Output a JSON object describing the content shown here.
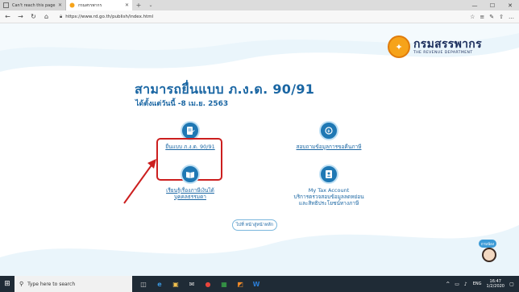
{
  "browser": {
    "tabs": [
      {
        "label": "Can't reach this page",
        "active": false,
        "icon": "broken-page-icon"
      },
      {
        "label": "กรมสรรพากร",
        "active": true,
        "icon": "rd-favicon"
      }
    ],
    "url": "https://www.rd.go.th/publish/index.html",
    "new_tab_glyph": "+",
    "tab_list_glyph": "⌄",
    "window_controls": [
      "—",
      "☐",
      "✕"
    ],
    "nav_glyphs": {
      "back": "←",
      "forward": "→",
      "refresh": "↻",
      "home": "⌂"
    },
    "tool_glyphs": [
      "☆",
      "≡",
      "✎",
      "⇧",
      "…"
    ]
  },
  "page": {
    "logo": {
      "thai": "กรมสรรพากร",
      "english": "THE REVENUE DEPARTMENT",
      "seal_glyph": "✦"
    },
    "headline": "สามารถยื่นแบบ ภ.ง.ด. 90/91",
    "subhead": "ได้ตั้งแต่วันนี้ -8 เม.ย. 2563",
    "items": {
      "file_return": {
        "label": "ยื่นแบบ ภ.ง.ด. 90/91",
        "icon": "document-form-icon"
      },
      "refund_status": {
        "label": "สอบถามข้อมูลการขอคืนภาษี",
        "icon": "search-refund-icon"
      },
      "learn": {
        "label_line1": "เรียนรู้เรื่องภาษีเงินได้",
        "label_line2": "บุคคลธรรมดา",
        "icon": "book-icon"
      },
      "my_tax": {
        "label_line1": "My Tax Account",
        "label_line2": "บริการตรวจสอบข้อมูลลดหย่อน",
        "label_line3": "และสิทธิประโยชน์ทางภาษี",
        "icon": "tax-account-icon"
      }
    },
    "back_home": "ไปที่ หน้าสู่หน้าหลัก",
    "chat_bubble": "ถามน้อง"
  },
  "taskbar": {
    "search_placeholder": "Type here to search",
    "start_glyph": "⊞",
    "search_glyph": "⚲",
    "apps": [
      "◫",
      "e",
      "▣",
      "✉",
      "●",
      "▦",
      "◩",
      "W"
    ],
    "tray_glyphs": [
      "^",
      "▭",
      "♪"
    ],
    "language": "ENG",
    "time": "16:47",
    "date": "1/2/2020",
    "notification_glyph": "▢"
  },
  "colors": {
    "brand": "#1a66a3",
    "highlight": "#cc1f1f",
    "accent": "#1f78b4"
  }
}
